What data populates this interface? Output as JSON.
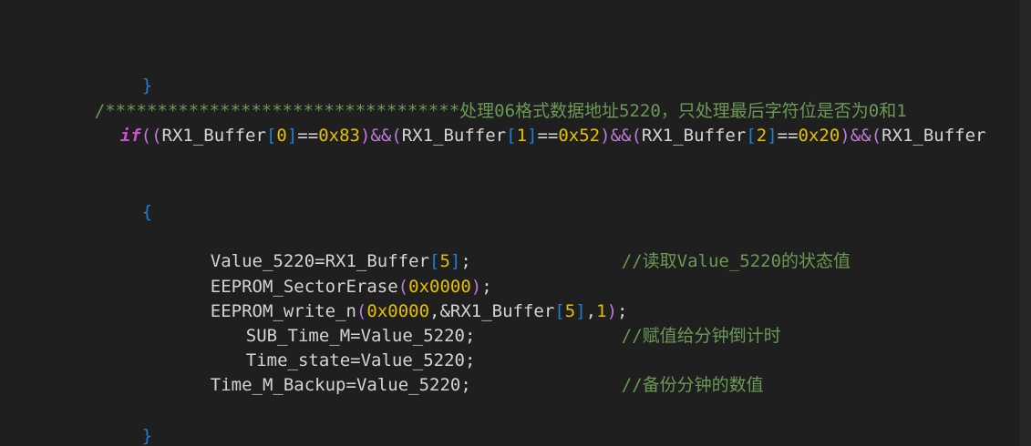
{
  "editor": {
    "lines": {
      "l1_brace_close": "}",
      "l2_comment": "/**********************************处理06格式数据地址5220，只处理最后字符位是否为0和1",
      "l3": {
        "kw_if": "if",
        "p1": "((",
        "a1": "RX1_Buffer",
        "b1o": "[",
        "i1": "0",
        "b1c": "]",
        "eq1": "==",
        "h1": "0x83",
        "c1": ")&&(",
        "a2": "RX1_Buffer",
        "b2o": "[",
        "i2": "1",
        "b2c": "]",
        "eq2": "==",
        "h2": "0x52",
        "c2": ")&&(",
        "a3": "RX1_Buffer",
        "b3o": "[",
        "i3": "2",
        "b3c": "]",
        "eq3": "==",
        "h3": "0x20",
        "c3": ")&&(",
        "a4": "RX1_Buffer"
      },
      "l4_brace_open": "{",
      "l5": {
        "lhs": "Value_5220",
        "eq": "=",
        "rhs": "RX1_Buffer",
        "bo": "[",
        "idx": "5",
        "bc": "]",
        "semi": ";",
        "comment": "//读取Value_5220的状态值"
      },
      "l6": {
        "fn": "EEPROM_SectorErase",
        "po": "(",
        "arg": "0x0000",
        "pc": ")",
        "semi": ";"
      },
      "l7": {
        "fn": "EEPROM_write_n",
        "po": "(",
        "arg1": "0x0000",
        "comma1": ",",
        "amp": "&RX1_Buffer",
        "bo": "[",
        "idx": "5",
        "bc": "]",
        "comma2": ",",
        "arg3": "1",
        "pc": ")",
        "semi": ";"
      },
      "l8": {
        "lhs": "SUB_Time_M",
        "eq": "=",
        "rhs": "Value_5220",
        "semi": ";",
        "comment": "//赋值给分钟倒计时"
      },
      "l9": {
        "lhs": "Time_state",
        "eq": "=",
        "rhs": "Value_5220",
        "semi": ";"
      },
      "l10": {
        "lhs": "Time_M_Backup",
        "eq": "=",
        "rhs": "Value_5220",
        "semi": ";",
        "comment": "//备份分钟的数值"
      },
      "l11_brace_close": "}"
    }
  }
}
